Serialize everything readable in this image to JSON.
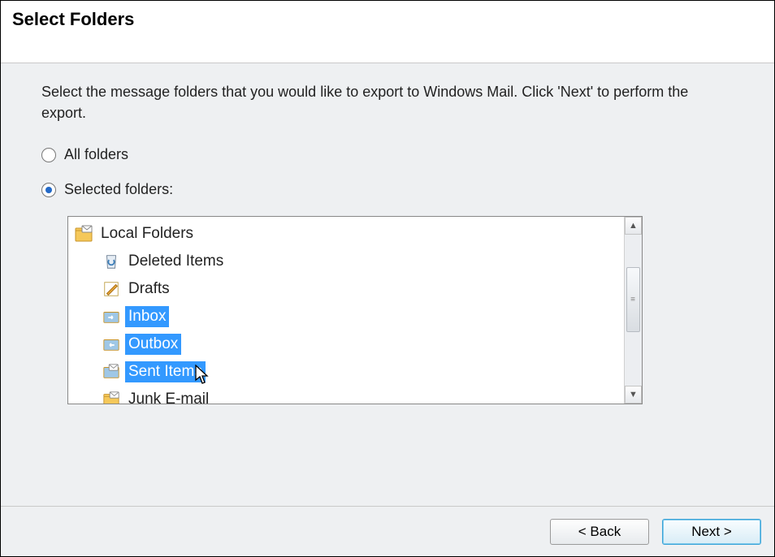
{
  "header": {
    "title": "Select Folders"
  },
  "instruction": "Select the message folders that you would like to export to Windows Mail. Click 'Next' to perform the export.",
  "radios": {
    "all": {
      "label": "All folders",
      "checked": false
    },
    "selected": {
      "label": "Selected folders:",
      "checked": true
    }
  },
  "tree": {
    "root": {
      "label": "Local Folders",
      "icon": "folder-mail-icon"
    },
    "children": [
      {
        "label": "Deleted Items",
        "icon": "recycle-bin-icon",
        "selected": false
      },
      {
        "label": "Drafts",
        "icon": "drafts-icon",
        "selected": false
      },
      {
        "label": "Inbox",
        "icon": "folder-arrow-icon",
        "selected": true
      },
      {
        "label": "Outbox",
        "icon": "folder-arrow-icon",
        "selected": true
      },
      {
        "label": "Sent Items",
        "icon": "folder-mail-icon",
        "selected": true
      },
      {
        "label": "Junk E-mail",
        "icon": "folder-mail-icon",
        "selected": false
      }
    ]
  },
  "buttons": {
    "back": "< Back",
    "next": "Next >"
  }
}
